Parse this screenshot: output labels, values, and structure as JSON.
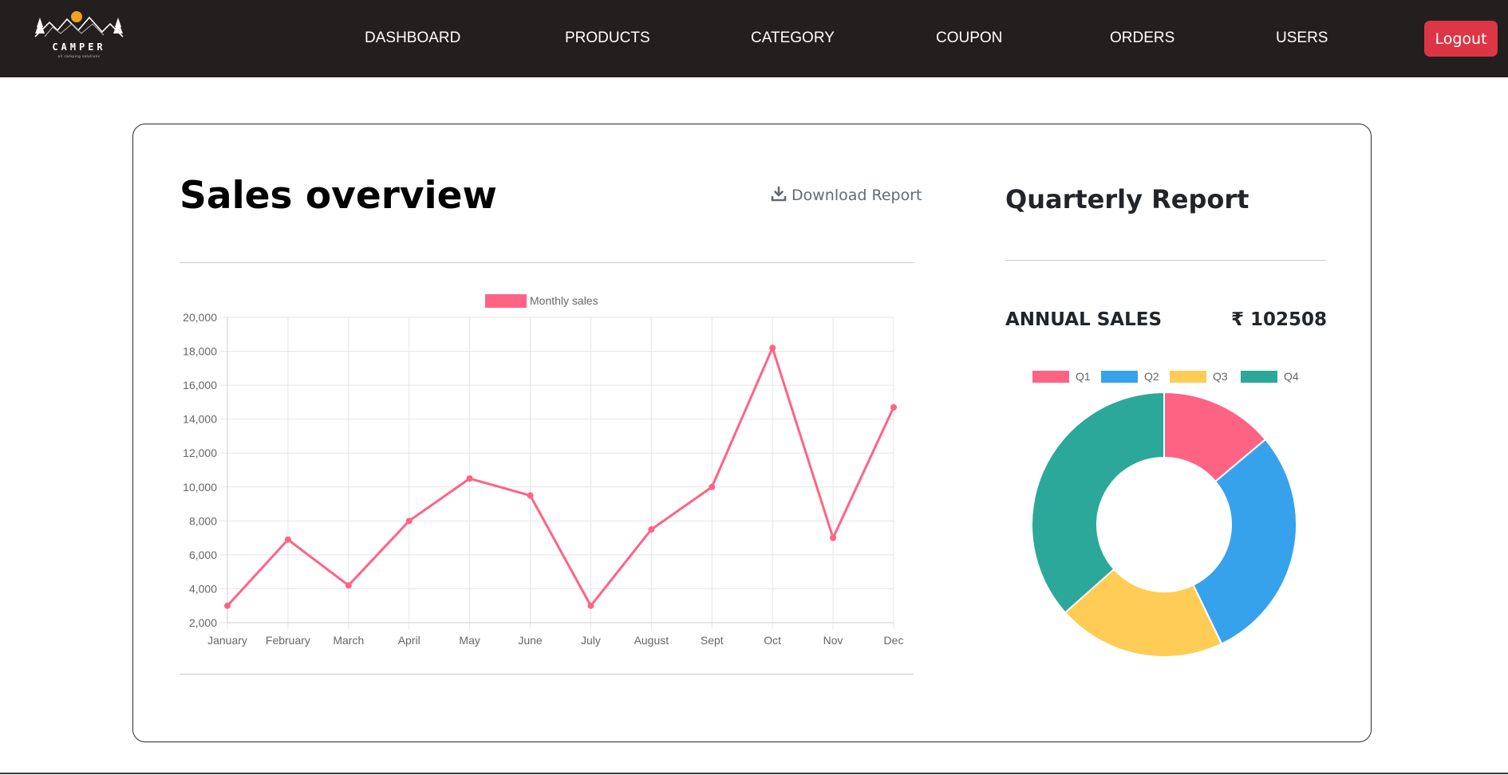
{
  "brand": {
    "name": "CAMPER",
    "tagline": "all camping solutions"
  },
  "nav": {
    "items": [
      {
        "label": "DASHBOARD"
      },
      {
        "label": "PRODUCTS"
      },
      {
        "label": "CATEGORY"
      },
      {
        "label": "COUPON"
      },
      {
        "label": "ORDERS"
      },
      {
        "label": "USERS"
      }
    ],
    "logout_label": "Logout"
  },
  "sales": {
    "title": "Sales overview",
    "download_label": "Download Report"
  },
  "quarterly": {
    "title": "Quarterly Report",
    "annual_label": "ANNUAL SALES",
    "annual_value": "₹ 102508"
  },
  "colors": {
    "nav_bg": "#231f1e",
    "logout": "#dc3545",
    "line_series": "#ff6384",
    "q1": "#ff6384",
    "q2": "#36a2eb",
    "q3": "#ffcd56",
    "q4": "#2ca89a"
  },
  "chart_data": [
    {
      "type": "line",
      "categories": [
        "January",
        "February",
        "March",
        "April",
        "May",
        "June",
        "July",
        "August",
        "Sept",
        "Oct",
        "Nov",
        "Dec"
      ],
      "series": [
        {
          "name": "Monthly sales",
          "color": "#ff6384",
          "values": [
            3000,
            6900,
            4200,
            8000,
            10500,
            9500,
            3000,
            7500,
            10000,
            18200,
            7000,
            14700
          ]
        }
      ],
      "yticks": [
        2000,
        4000,
        6000,
        8000,
        10000,
        12000,
        14000,
        16000,
        18000,
        20000
      ],
      "ytick_labels": [
        "2,000",
        "4,000",
        "6,000",
        "8,000",
        "10,000",
        "12,000",
        "14,000",
        "16,000",
        "18,000",
        "20,000"
      ],
      "ylim": [
        2000,
        20000
      ],
      "grid": true,
      "legend": "top"
    },
    {
      "type": "pie",
      "variant": "doughnut",
      "labels": [
        "Q1",
        "Q2",
        "Q3",
        "Q4"
      ],
      "values": [
        14208,
        29712,
        21100,
        37488
      ],
      "colors": [
        "#ff6384",
        "#36a2eb",
        "#ffcd56",
        "#2ca89a"
      ],
      "legend": "top"
    }
  ]
}
